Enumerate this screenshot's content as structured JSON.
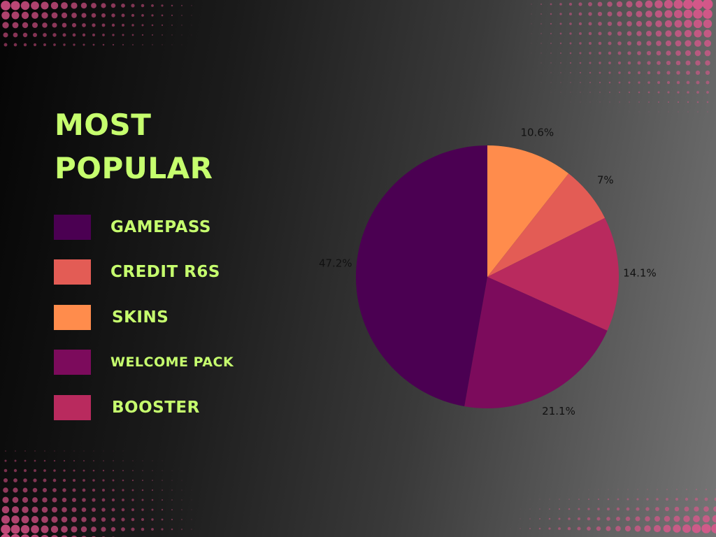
{
  "title_lines": [
    "MOST",
    "POPULAR"
  ],
  "colors": {
    "title": "#c6ff6e",
    "legend_text": "#c6ff6e",
    "dots": "#e3558e"
  },
  "chart_data": {
    "type": "pie",
    "legend_placement": "left",
    "slices": [
      {
        "name": "SKINS",
        "value": 10.6,
        "label": "10.6%",
        "color": "#ff8c4c"
      },
      {
        "name": "CREDIT R6S",
        "value": 7.0,
        "label": "7%",
        "color": "#e35c55"
      },
      {
        "name": "BOOSTER",
        "value": 14.1,
        "label": "14.1%",
        "color": "#b92a5e"
      },
      {
        "name": "WELCOME PACK",
        "value": 21.1,
        "label": "21.1%",
        "color": "#7c0b5c"
      },
      {
        "name": "GAMEPASS",
        "value": 47.2,
        "label": "47.2%",
        "color": "#4b0052"
      }
    ],
    "legend": [
      {
        "label": "GAMEPASS",
        "color": "#4b0052"
      },
      {
        "label": "CREDIT R6S",
        "color": "#e35c55"
      },
      {
        "label": "SKINS",
        "color": "#ff8c4c"
      },
      {
        "label": "WELCOME PACK",
        "color": "#7c0b5c"
      },
      {
        "label": "BOOSTER",
        "color": "#b92a5e"
      }
    ]
  }
}
